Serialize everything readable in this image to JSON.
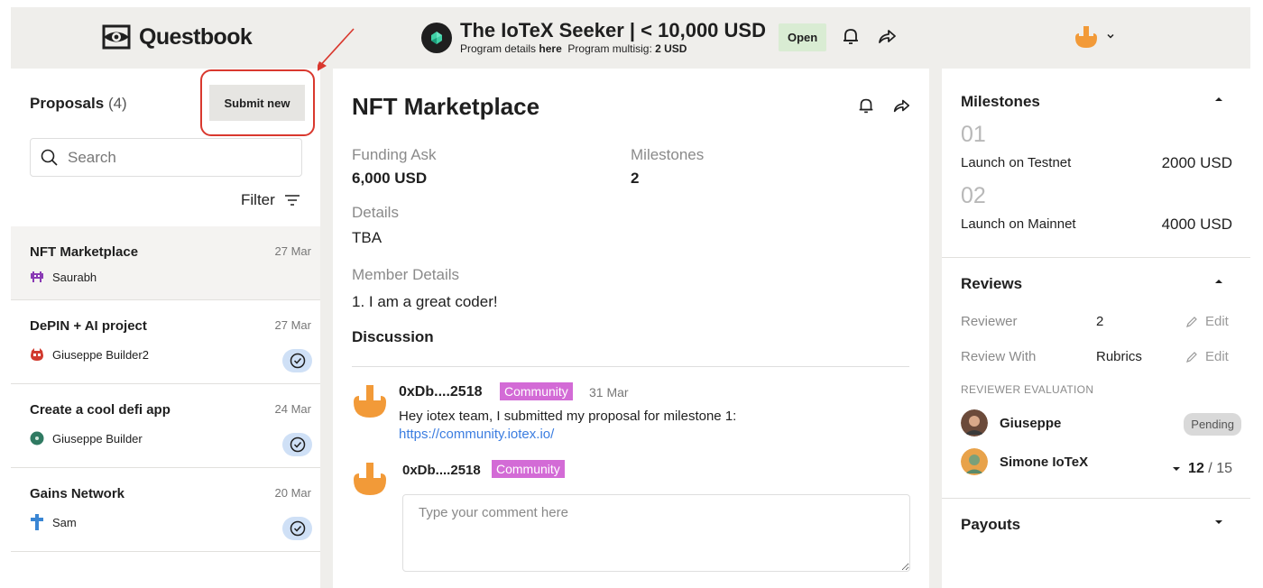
{
  "header": {
    "logo_text": "Questbook",
    "program_title": "The IoTeX Seeker | < 10,000 USD",
    "program_details_prefix": "Program details",
    "program_details_link": "here",
    "multisig_label": "Program multisig:",
    "multisig_value": "2 USD",
    "status": "Open"
  },
  "proposals": {
    "title": "Proposals",
    "count": "(4)",
    "submit_label": "Submit new",
    "search_placeholder": "Search",
    "filter_label": "Filter",
    "items": [
      {
        "name": "NFT Marketplace",
        "date": "27 Mar",
        "author": "Saurabh",
        "icon": "space-invader-avatar-icon",
        "reviewed": false
      },
      {
        "name": "DePIN + AI project",
        "date": "27 Mar",
        "author": "Giuseppe Builder2",
        "icon": "red-creature-avatar-icon",
        "reviewed": true
      },
      {
        "name": "Create a cool defi app",
        "date": "24 Mar",
        "author": "Giuseppe Builder",
        "icon": "green-circle-avatar-icon",
        "reviewed": true
      },
      {
        "name": "Gains Network",
        "date": "20 Mar",
        "author": "Sam",
        "icon": "blue-cross-avatar-icon",
        "reviewed": true
      }
    ]
  },
  "detail": {
    "title": "NFT Marketplace",
    "funding_ask_label": "Funding Ask",
    "funding_ask_value": "6,000 USD",
    "milestones_label": "Milestones",
    "milestones_value": "2",
    "details_label": "Details",
    "details_value": "TBA",
    "member_label": "Member Details",
    "member_value": "1. I am a great coder!",
    "discussion_label": "Discussion",
    "comments": [
      {
        "author": "0xDb....2518",
        "tag": "Community",
        "date": "31 Mar",
        "text": "Hey iotex team, I submitted my proposal for milestone 1:",
        "link": "https://community.iotex.io/"
      }
    ],
    "composer": {
      "author": "0xDb....2518",
      "tag": "Community",
      "placeholder": "Type your comment here"
    }
  },
  "sidebar": {
    "milestones_title": "Milestones",
    "milestones": [
      {
        "num": "01",
        "name": "Launch on Testnet",
        "amount": "2000 USD"
      },
      {
        "num": "02",
        "name": "Launch on Mainnet",
        "amount": "4000 USD"
      }
    ],
    "reviews_title": "Reviews",
    "reviewer_label": "Reviewer",
    "reviewer_value": "2",
    "review_with_label": "Review With",
    "review_with_value": "Rubrics",
    "edit_label": "Edit",
    "evaluation_caption": "REVIEWER EVALUATION",
    "reviewers": [
      {
        "name": "Giuseppe",
        "status": "Pending"
      },
      {
        "name": "Simone IoTeX",
        "score": "12",
        "total": "15"
      }
    ],
    "payouts_title": "Payouts"
  },
  "colors": {
    "background": "#efeeeb",
    "status_open": "#d9ecd3",
    "community_tag": "#d36bd6",
    "link": "#3b7de0",
    "annotation": "#d9382e",
    "reviewed_badge": "#cfe0f6"
  }
}
